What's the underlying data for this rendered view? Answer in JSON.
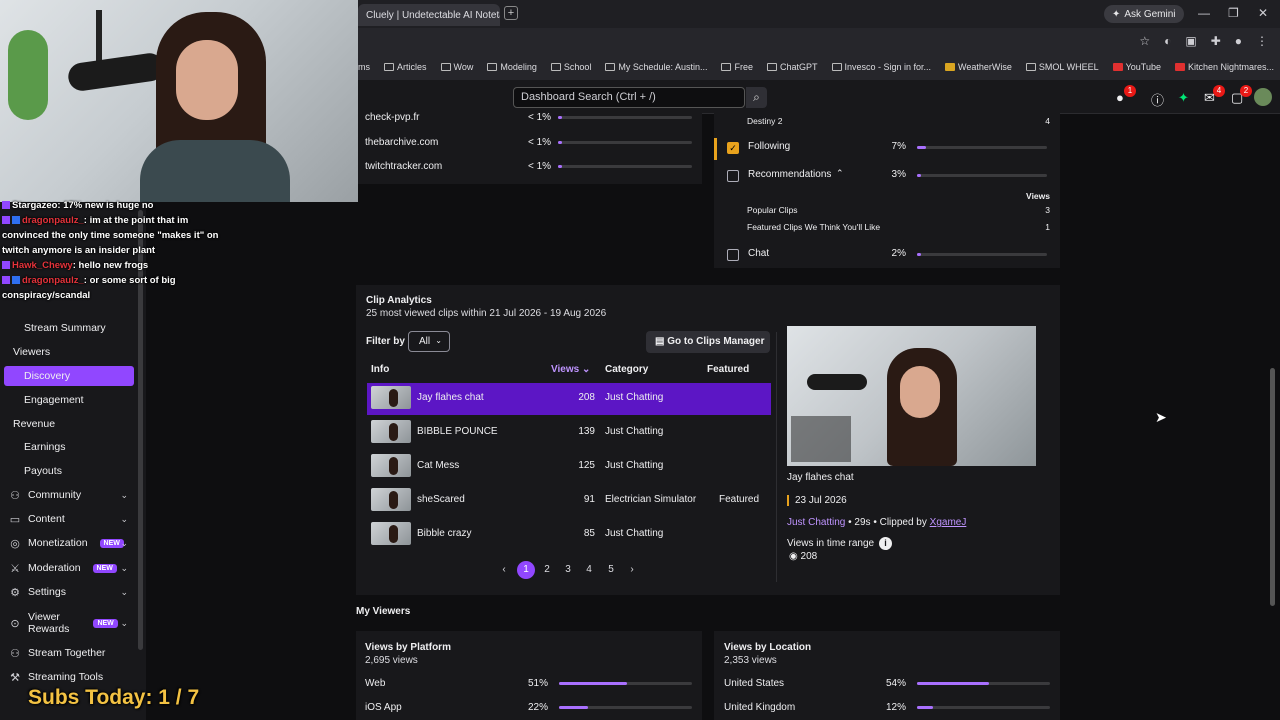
{
  "browser": {
    "tab_title": "Cluely | Undetectable AI Notetaker",
    "new_tab": "+",
    "ask_gemini": "Ask Gemini",
    "bookmarks": [
      "ms",
      "Articles",
      "Wow",
      "Modeling",
      "School",
      "My Schedule: Austin...",
      "Free",
      "ChatGPT",
      "Invesco - Sign in for...",
      "WeatherWise",
      "SMOL WHEEL",
      "YouTube",
      "Kitchen Nightmares..."
    ]
  },
  "topbar": {
    "search_placeholder": "Dashboard Search (Ctrl + /)",
    "badges": {
      "notifications": "1",
      "inbox": "4",
      "whispers": "2"
    }
  },
  "sidebar": {
    "items": {
      "stream_summary": "Stream Summary",
      "viewers": "Viewers",
      "discovery": "Discovery",
      "engagement": "Engagement",
      "revenue": "Revenue",
      "earnings": "Earnings",
      "payouts": "Payouts",
      "community": "Community",
      "content": "Content",
      "monetization": "Monetization",
      "moderation": "Moderation",
      "settings": "Settings",
      "viewer_rewards_1": "Viewer",
      "viewer_rewards_2": "Rewards",
      "stream_together": "Stream Together",
      "streaming_tools": "Streaming Tools"
    },
    "new_badge": "NEW"
  },
  "chat": [
    {
      "name": "Stargazeo",
      "text": ": 17% new is huge no"
    },
    {
      "name": "dragonpaulz_",
      "text": ": im at the point that im convinced the only time someone \"makes it\" on twitch anymore is an insider plant"
    },
    {
      "name": "Hawk_Chewy",
      "text": ": hello new frogs"
    },
    {
      "name": "dragonpaulz_",
      "text": ": or some sort of big conspiracy/scandal"
    }
  ],
  "subs_overlay": "Subs Today: 1 / 7",
  "external_referrers": [
    {
      "site": "check-pvp.fr",
      "pct": "< 1%",
      "value": 0.01
    },
    {
      "site": "thebarchive.com",
      "pct": "< 1%",
      "value": 0.01
    },
    {
      "site": "twitchtracker.com",
      "pct": "< 1%",
      "value": 0.01
    }
  ],
  "sources": {
    "destiny": {
      "label": "Destiny 2",
      "count": "4"
    },
    "following": {
      "label": "Following",
      "pct": "7%",
      "value": 0.07
    },
    "recommendations": {
      "label": "Recommendations",
      "pct": "3%",
      "value": 0.03
    },
    "views_header": "Views",
    "sub_items": [
      {
        "label": "Popular Clips",
        "count": "3"
      },
      {
        "label": "Featured Clips We Think You'll Like",
        "count": "1"
      }
    ],
    "chat": {
      "label": "Chat",
      "pct": "2%",
      "value": 0.02
    }
  },
  "clip_analytics": {
    "title": "Clip Analytics",
    "subtitle": "25 most viewed clips within 21 Jul 2026 - 19 Aug 2026",
    "filter_label": "Filter by",
    "filter_value": "All",
    "clips_manager": "Go to Clips Manager",
    "columns": {
      "info": "Info",
      "views": "Views",
      "category": "Category",
      "featured": "Featured"
    },
    "rows": [
      {
        "title": "Jay flahes chat",
        "views": "208",
        "category": "Just Chatting",
        "featured": ""
      },
      {
        "title": "BIBBLE POUNCE",
        "views": "139",
        "category": "Just Chatting",
        "featured": ""
      },
      {
        "title": "Cat Mess",
        "views": "125",
        "category": "Just Chatting",
        "featured": ""
      },
      {
        "title": "sheScared",
        "views": "91",
        "category": "Electrician Simulator",
        "featured": "Featured"
      },
      {
        "title": "Bibble crazy",
        "views": "85",
        "category": "Just Chatting",
        "featured": ""
      }
    ],
    "pages": [
      "1",
      "2",
      "3",
      "4",
      "5"
    ],
    "preview": {
      "title": "Jay flahes chat",
      "date": "23 Jul 2026",
      "category": "Just Chatting",
      "duration": " • 29s • Clipped by ",
      "clipper": "XgameJ",
      "views_label": "Views in time range",
      "views": "208"
    }
  },
  "my_viewers": {
    "title": "My Viewers",
    "platform": {
      "title": "Views by Platform",
      "total": "2,695 views",
      "rows": [
        {
          "label": "Web",
          "pct": "51%",
          "value": 0.51
        },
        {
          "label": "iOS App",
          "pct": "22%",
          "value": 0.22
        }
      ]
    },
    "location": {
      "title": "Views by Location",
      "total": "2,353 views",
      "rows": [
        {
          "label": "United States",
          "pct": "54%",
          "value": 0.54
        },
        {
          "label": "United Kingdom",
          "pct": "12%",
          "value": 0.12
        }
      ]
    }
  }
}
